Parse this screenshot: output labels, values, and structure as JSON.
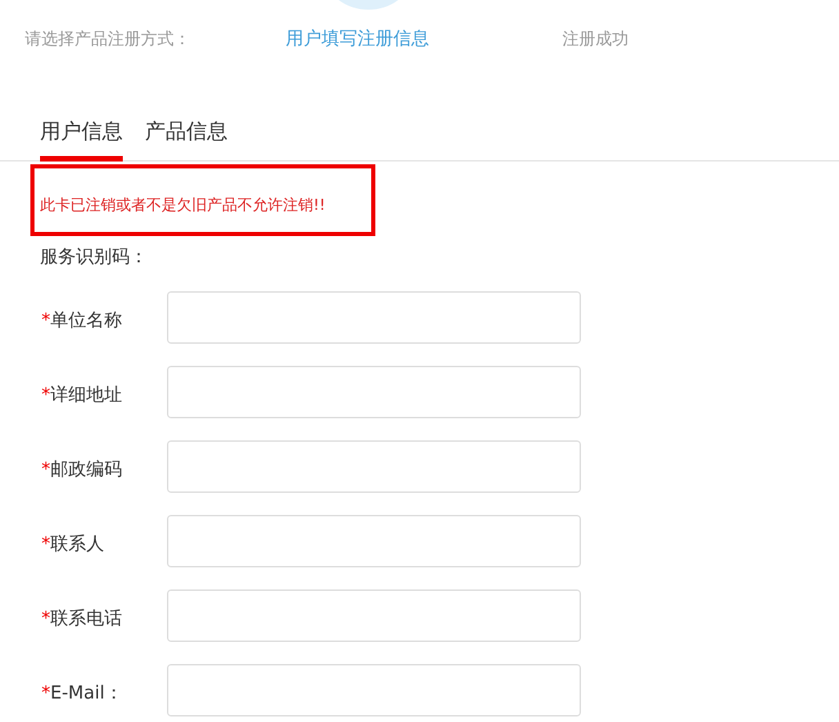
{
  "steps": {
    "label": "请选择产品注册方式：",
    "items": [
      {
        "label": "用户填写注册信息",
        "selected": true
      },
      {
        "label": "注册成功",
        "selected": false
      }
    ]
  },
  "tabs": [
    {
      "label": "用户信息",
      "selected": true
    },
    {
      "label": "产品信息",
      "selected": false
    }
  ],
  "error_message": "此卡已注销或者不是欠旧产品不允许注销!!",
  "service_code": {
    "label": "服务识别码："
  },
  "fields": [
    {
      "label": "单位名称",
      "required": true
    },
    {
      "label": "详细地址",
      "required": true
    },
    {
      "label": "邮政编码",
      "required": true
    },
    {
      "label": "联系人",
      "required": true
    },
    {
      "label": "联系电话",
      "required": true
    },
    {
      "label": "E-Mail：",
      "required": true
    }
  ],
  "required_mark": "*"
}
